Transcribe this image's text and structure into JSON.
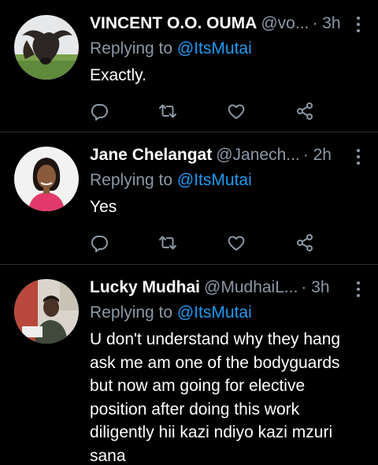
{
  "tweets": [
    {
      "name": "VINCENT O.O. OUMA",
      "handle": "@vo...",
      "time": "· 3h",
      "replying_prefix": "Replying to",
      "replying_to": "@ItsMutai",
      "text": "Exactly."
    },
    {
      "name": "Jane Chelangat",
      "handle": "@Janech...",
      "time": "· 2h",
      "replying_prefix": "Replying to",
      "replying_to": "@ItsMutai",
      "text": "Yes"
    },
    {
      "name": "Lucky Mudhai",
      "handle": "@MudhaiL...",
      "time": "· 3h",
      "replying_prefix": "Replying to",
      "replying_to": "@ItsMutai",
      "text": "U don't understand why they hang ask me am one of the bodyguards but now am going for elective position after doing this work diligently hii kazi ndiyo kazi mzuri sana"
    }
  ],
  "icons": {
    "reply": "reply-icon",
    "retweet": "retweet-icon",
    "like": "heart-icon",
    "share": "share-icon",
    "more": "more-vertical-icon"
  },
  "colors": {
    "background": "#000000",
    "text": "#ffffff",
    "secondary": "#8b98a5",
    "accent": "#1d9bf0",
    "divider": "#2f3336"
  }
}
